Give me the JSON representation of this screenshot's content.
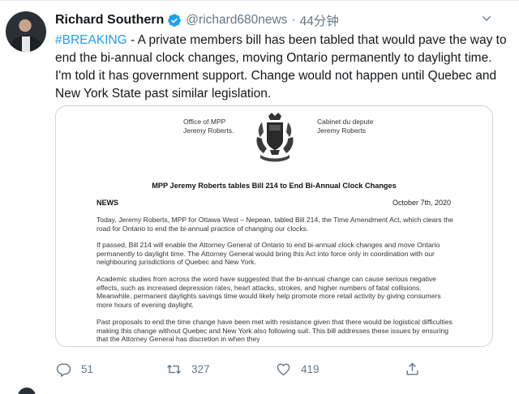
{
  "tweet": {
    "display_name": "Richard Southern",
    "handle": "@richard680news",
    "separator": "·",
    "time": "44分钟",
    "hashtag": "#BREAKING",
    "text": " - A private members bill has been tabled that would pave the way to end the bi-annual clock changes, moving Ontario permanently to daylight time. I'm told  it has government support. Change would not happen until Quebec and New York State past similar legislation."
  },
  "document": {
    "office_en_line1": "Office of MPP",
    "office_en_line2": "Jeremy Roberts.",
    "office_fr_line1": "Cabinet du depute",
    "office_fr_line2": "Jeremy Roberts",
    "title": "MPP Jeremy Roberts tables Bill 214 to End Bi-Annual Clock Changes",
    "news_label": "NEWS",
    "date": "October 7th, 2020",
    "paragraph1": "Today, Jeremy Roberts, MPP for Ottawa West – Nepean, tabled Bill 214, the Time Amendment Act, which clears the road for Ontario to end the bi-annual practice of changing our clocks.",
    "paragraph2": "If passed, Bill 214 will enable the Attorney General of Ontario to end bi-annual clock changes and move Ontario permanently to daylight time. The Attorney General would bring this Act into force only in coordination with our neighbouring jurisdictions of Quebec and New York.",
    "paragraph3": "Academic studies from across the word have suggested that the bi-annual change can cause serious negative effects, such as increased depression rates, heart attacks, strokes, and higher numbers of fatal collisions. Meanwhile, permanent daylights savings time would likely help promote more retail activity by giving consumers more hours of evening daylight.",
    "paragraph4": "Past proposals to end the time change have been met with resistance given that there would be logistical difficulties making this change without Quebec and New York also following suit. This bill addresses these issues by ensuring that the Attorney General has discretion in when they"
  },
  "actions": {
    "replies": "51",
    "retweets": "327",
    "likes": "419"
  },
  "icons": {
    "verified": "verified-badge-icon",
    "caret": "chevron-down-icon",
    "reply": "reply-icon",
    "retweet": "retweet-icon",
    "like": "heart-icon",
    "share": "share-icon"
  },
  "colors": {
    "accent": "#1da1f2",
    "text": "#14171a",
    "secondary": "#657786",
    "border": "#ccd6dd"
  }
}
